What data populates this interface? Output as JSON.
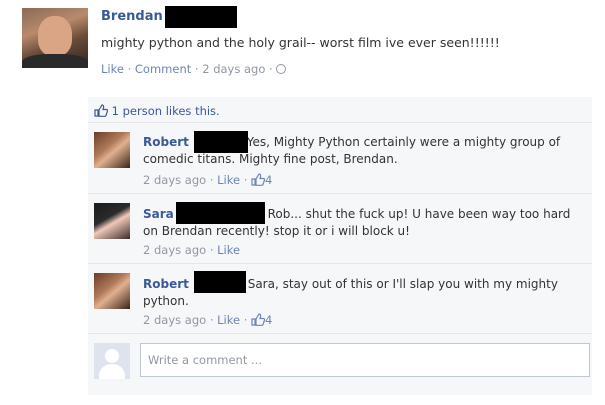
{
  "post": {
    "author_first": "Brendan",
    "text": "mighty python and the holy grail-- worst film ive ever seen!!!!!!",
    "like_link": "Like",
    "comment_link": "Comment",
    "time": "2 days ago",
    "sep": "·"
  },
  "likes": {
    "text": "1 person likes this."
  },
  "comments": [
    {
      "name": "Robert",
      "text": "Yes, Mighty Python certainly were a mighty group of comedic titans. Mighty fine post, Brendan.",
      "time": "2 days ago",
      "like_label": "Like",
      "like_count": "4"
    },
    {
      "name": "Sara",
      "text": "Rob... shut the fuck up! U have been way too hard on Brendan recently! stop it or i will block u!",
      "time": "2 days ago",
      "like_label": "Like"
    },
    {
      "name": "Robert",
      "text": "Sara, stay out of this or I'll slap you with my mighty python.",
      "time": "2 days ago",
      "like_label": "Like",
      "like_count": "4"
    }
  ],
  "composer": {
    "placeholder": "Write a comment ..."
  },
  "colors": {
    "link": "#3b5998",
    "muted_link": "#6d84b4",
    "meta": "#9197a3",
    "panel_bg": "#f6f7f9",
    "redaction": "#000000"
  },
  "icons": [
    "thumbs-up-icon",
    "globe-icon",
    "default-avatar-icon"
  ]
}
